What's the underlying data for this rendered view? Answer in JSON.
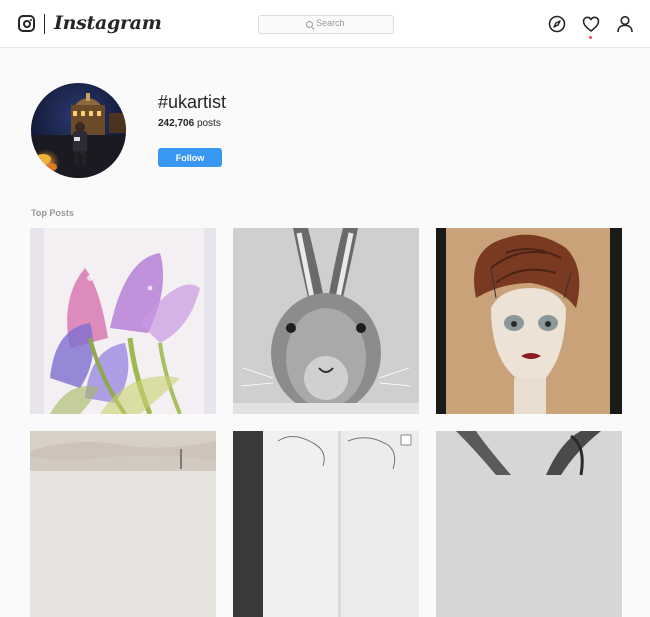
{
  "header": {
    "brand": "Instagram",
    "search_placeholder": "Search",
    "nav_icons": [
      "compass-icon",
      "heart-icon",
      "user-icon"
    ],
    "notification_dot_color": "#ed4956"
  },
  "profile": {
    "hashtag": "#ukartist",
    "post_count": "242,706",
    "posts_label": "posts",
    "follow_label": "Follow",
    "accent_color": "#3897f0"
  },
  "top_posts": {
    "label": "Top Posts",
    "items": [
      {
        "subject": "watercolor flowers"
      },
      {
        "subject": "pencil hare drawing"
      },
      {
        "subject": "portrait painting"
      },
      {
        "subject": "landscape watercolor"
      },
      {
        "subject": "sketchbook drawings"
      },
      {
        "subject": "pencil animal drawing"
      }
    ]
  }
}
